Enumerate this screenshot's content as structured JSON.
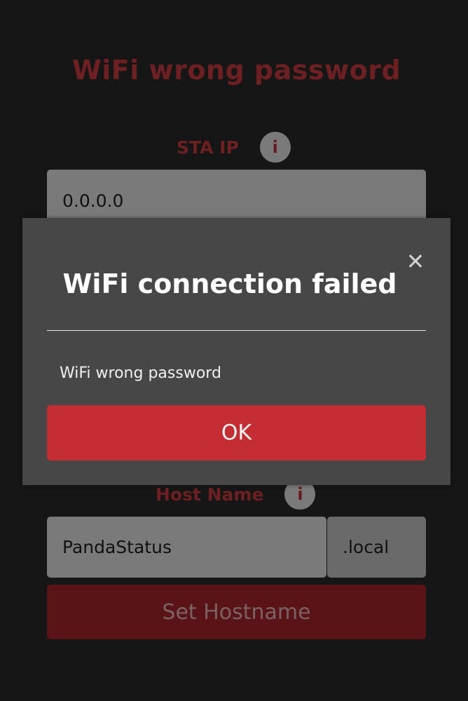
{
  "page": {
    "title": "WiFi wrong password"
  },
  "sta_ip": {
    "label": "STA IP",
    "info_glyph": "i",
    "value": "0.0.0.0"
  },
  "host_name": {
    "label": "Host Name",
    "info_glyph": "i",
    "value": "PandaStatus",
    "suffix": ".local",
    "button_label": "Set Hostname"
  },
  "modal": {
    "close_glyph": "✕",
    "title": "WiFi connection failed",
    "message": "WiFi wrong password",
    "ok_label": "OK"
  },
  "colors": {
    "background": "#161616",
    "accent_red": "#c42d31",
    "dimmed_red_text": "#6e1f22",
    "modal_background": "#474747"
  },
  "icons": {
    "info": "info-icon",
    "close": "close-icon"
  }
}
